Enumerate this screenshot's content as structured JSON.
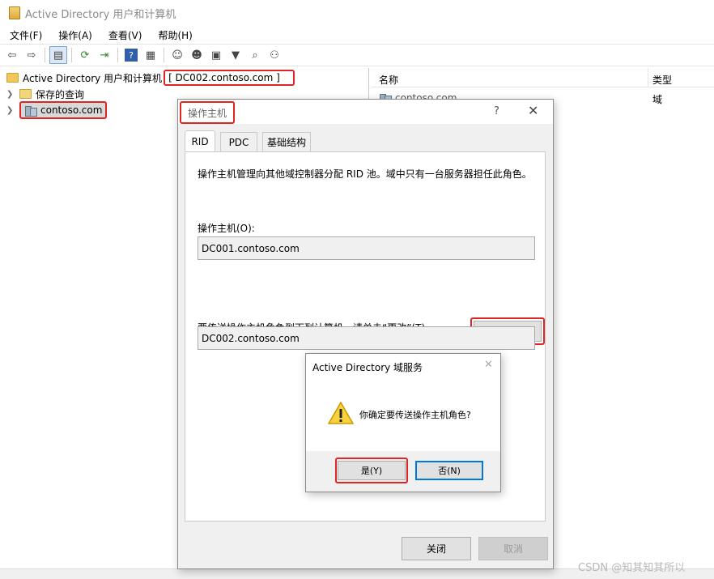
{
  "window": {
    "title": "Active Directory 用户和计算机"
  },
  "menu": [
    "文件(F)",
    "操作(A)",
    "查看(V)",
    "帮助(H)"
  ],
  "toolbar_icons": [
    "back-arrow-icon",
    "forward-arrow-icon",
    "console-tree-icon",
    "refresh-icon",
    "export-list-icon",
    "help-icon",
    "properties-pane-icon",
    "user-icon",
    "group-icon",
    "ou-icon",
    "filter-icon",
    "find-icon",
    "add-to-group-icon"
  ],
  "tree": {
    "root_label": "Active Directory 用户和计算机",
    "root_server": "[ DC002.contoso.com ]",
    "items": [
      {
        "label": "保存的查询",
        "icon": "folder-icon"
      },
      {
        "label": "contoso.com",
        "icon": "domain-icon"
      }
    ]
  },
  "list": {
    "columns": [
      "名称",
      "类型"
    ],
    "rows": [
      {
        "name": "contoso.com",
        "type": "域"
      }
    ]
  },
  "dialog": {
    "title": "操作主机",
    "help": "?",
    "close": "✕",
    "tabs": [
      "RID",
      "PDC",
      "基础结构"
    ],
    "active_tab": "RID",
    "description": "操作主机管理向其他域控制器分配 RID 池。域中只有一台服务器担任此角色。",
    "master_label": "操作主机(O):",
    "master_value": "DC001.contoso.com",
    "transfer_instruction": "要传送操作主机角色到下列计算机，请单击“更改”(T)。",
    "change_button": "更改(C)...",
    "target_value": "DC002.contoso.com",
    "close_button": "关闭",
    "cancel_button": "取消"
  },
  "confirm": {
    "title": "Active Directory 域服务",
    "close": "✕",
    "message": "你确定要传送操作主机角色?",
    "yes": "是(Y)",
    "no": "否(N)"
  },
  "watermark": "CSDN @知其知其所以",
  "colors": {
    "highlight": "#e02424",
    "focus": "#0078d7"
  }
}
